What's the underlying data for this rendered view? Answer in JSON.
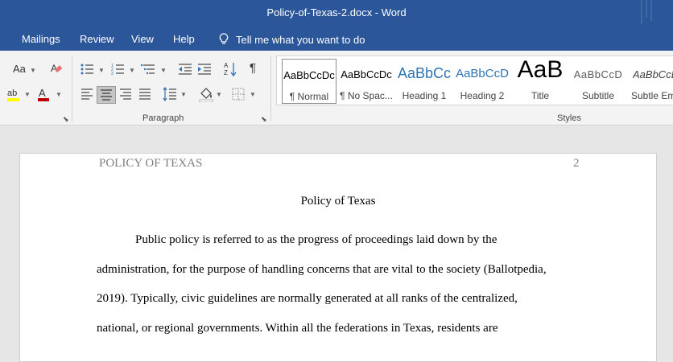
{
  "window": {
    "title": "Policy-of-Texas-2.docx  -  Word"
  },
  "tabs": [
    {
      "label": "Mailings"
    },
    {
      "label": "Review"
    },
    {
      "label": "View"
    },
    {
      "label": "Help"
    }
  ],
  "tellme": {
    "label": "Tell me what you want to do",
    "icon": "lightbulb-icon"
  },
  "ribbon": {
    "groups": {
      "paragraph_label": "Paragraph",
      "styles_label": "Styles"
    },
    "font_controls": {
      "change_case_label": "Aa",
      "highlight_color": "#ffff00",
      "font_color": "#c00000"
    },
    "styles": [
      {
        "sample": "AaBbCcDc",
        "name": "¶ Normal",
        "selected": true
      },
      {
        "sample": "AaBbCcDc",
        "name": "¶ No Spac..."
      },
      {
        "sample": "AaBbCc",
        "name": "Heading 1"
      },
      {
        "sample": "AaBbCcD",
        "name": "Heading 2"
      },
      {
        "sample": "AaB",
        "name": "Title"
      },
      {
        "sample": "AaBbCcD",
        "name": "Subtitle"
      },
      {
        "sample": "AaBbCcL",
        "name": "Subtle Em"
      }
    ]
  },
  "document": {
    "header_left": "POLICY OF TEXAS",
    "header_page_number": "2",
    "title": "Policy of Texas",
    "lines": [
      "Public policy is referred to as the progress of proceedings laid down by the",
      "administration, for the purpose of handling concerns that are vital to the society (Ballotpedia,",
      "2019). Typically, civic guidelines are normally generated at all ranks of the centralized,",
      "national, or regional governments. Within all the federations in Texas, residents are"
    ]
  },
  "colors": {
    "titlebar": "#2b579a",
    "heading_blue": "#2e74b5"
  }
}
